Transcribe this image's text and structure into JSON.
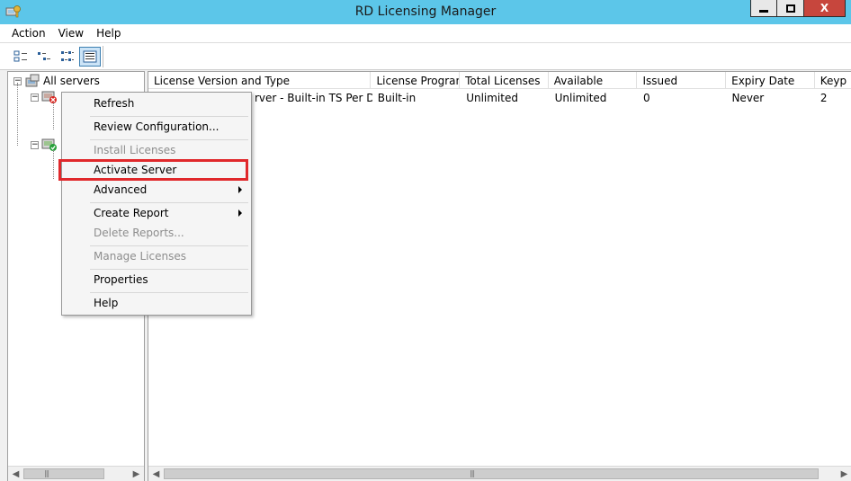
{
  "window": {
    "title": "RD Licensing Manager",
    "minimize": "minimize",
    "maximize": "maximize",
    "close": "X"
  },
  "menubar": {
    "items": [
      "Action",
      "View",
      "Help"
    ]
  },
  "toolbar": {
    "buttons": [
      "large-icons-view",
      "small-icons-view",
      "list-view",
      "details-view"
    ]
  },
  "tree": {
    "root_label": "All servers"
  },
  "list": {
    "columns": [
      "License Version and Type",
      "License Program",
      "Total Licenses",
      "Available",
      "Issued",
      "Expiry Date",
      "Keyp"
    ],
    "rows": [
      {
        "license_version": "Windows Server - Built-in TS Per De…",
        "license_version_visible": "rver - Built-in TS Per De…",
        "program": "Built-in",
        "total": "Unlimited",
        "available": "Unlimited",
        "issued": "0",
        "expiry": "Never",
        "keypack": "2"
      }
    ]
  },
  "context_menu": {
    "items": [
      {
        "label": "Refresh",
        "enabled": true
      },
      {
        "label": "Review Configuration...",
        "enabled": true
      },
      {
        "label": "Install Licenses",
        "enabled": false
      },
      {
        "label": "Activate Server",
        "enabled": true,
        "highlighted": true
      },
      {
        "label": "Advanced",
        "enabled": true,
        "submenu": true
      },
      {
        "label": "Create Report",
        "enabled": true,
        "submenu": true
      },
      {
        "label": "Delete Reports...",
        "enabled": false
      },
      {
        "label": "Manage Licenses",
        "enabled": false
      },
      {
        "label": "Properties",
        "enabled": true
      },
      {
        "label": "Help",
        "enabled": true
      }
    ]
  },
  "colors": {
    "titlebar": "#5cc6e9",
    "close_button": "#c7463d",
    "highlight_outline": "#e0282b"
  }
}
